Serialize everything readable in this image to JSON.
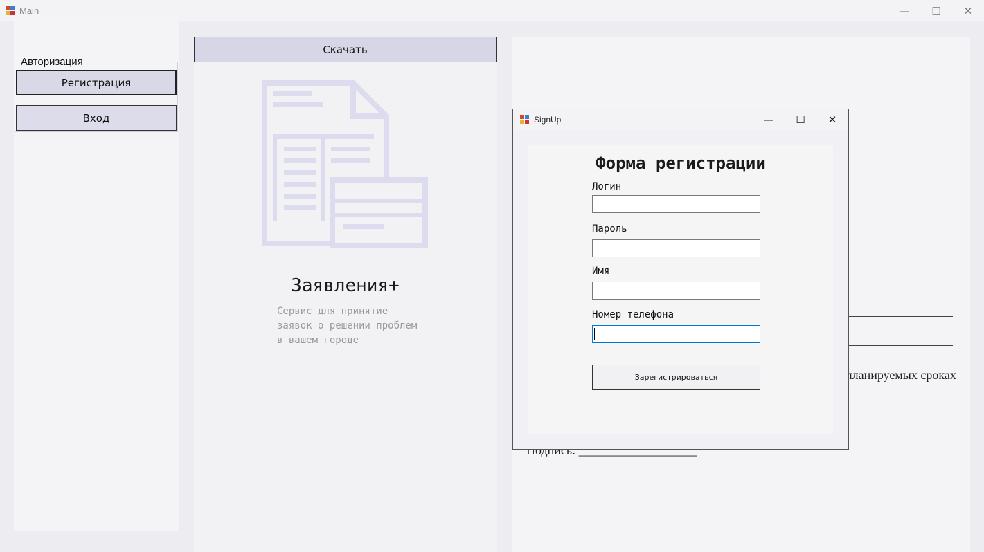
{
  "main_window": {
    "title": "Main",
    "controls": {
      "minimize": "—",
      "maximize": "☐",
      "close": "✕"
    }
  },
  "auth_group": {
    "label": "Авторизация",
    "register_button": "Регистрация",
    "login_button": "Вход"
  },
  "center": {
    "download_button": "Скачать",
    "brand_title": "Заявления+",
    "brand_desc": [
      "Сервис для принятие",
      "заявок о решении проблем",
      "в вашем городе"
    ]
  },
  "document": {
    "planned_text": "планируемых сроках",
    "signature_text": "Подпись: ___________________"
  },
  "signup_dialog": {
    "title": "SignUp",
    "form_title": "Форма регистрации",
    "fields": [
      {
        "label": "Логин",
        "value": ""
      },
      {
        "label": "Пароль",
        "value": ""
      },
      {
        "label": "Имя",
        "value": ""
      },
      {
        "label": "Номер телефона",
        "value": ""
      }
    ],
    "submit_button": "Зарегистрироваться",
    "controls": {
      "minimize": "—",
      "maximize": "☐",
      "close": "✕"
    }
  },
  "colors": {
    "accent_focus": "#0078d7",
    "button_fill": "#d8d8e6",
    "illustration": "#dcdcee"
  },
  "icons": {
    "app": "app-icon",
    "illustration": "documents-illustration-icon"
  }
}
